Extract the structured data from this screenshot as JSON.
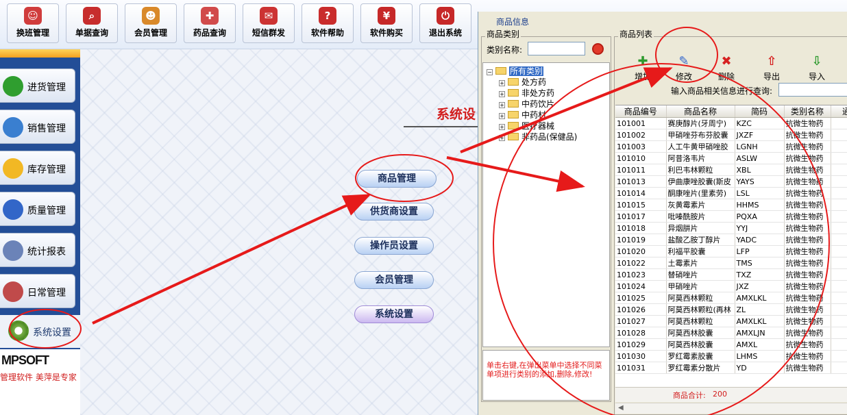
{
  "toolbar": {
    "buttons": [
      {
        "label": "换班管理",
        "icon": "user-switch-icon",
        "color": "#d03c3c"
      },
      {
        "label": "单据查询",
        "icon": "magnifier-icon",
        "color": "#c72d2d"
      },
      {
        "label": "会员管理",
        "icon": "member-icon",
        "color": "#d9892a"
      },
      {
        "label": "药品查询",
        "icon": "medicine-box-icon",
        "color": "#d14b4b"
      },
      {
        "label": "短信群发",
        "icon": "envelope-icon",
        "color": "#cc3333"
      },
      {
        "label": "软件帮助",
        "icon": "help-icon",
        "color": "#c92c2c"
      },
      {
        "label": "软件购买",
        "icon": "yen-icon",
        "color": "#c62828"
      },
      {
        "label": "退出系统",
        "icon": "power-icon",
        "color": "#c62828"
      }
    ]
  },
  "sidebar": {
    "items": [
      {
        "label": "进货管理",
        "icon": "plus-icon",
        "color": "#2f9e2f"
      },
      {
        "label": "销售管理",
        "icon": "pie-chart-icon",
        "color": "#3a7fd0"
      },
      {
        "label": "库存管理",
        "icon": "star-icon",
        "color": "#f2b824"
      },
      {
        "label": "质量管理",
        "icon": "cubes-icon",
        "color": "#3266c8"
      },
      {
        "label": "统计报表",
        "icon": "bar-chart-icon",
        "color": "#6b83b8"
      },
      {
        "label": "日常管理",
        "icon": "tools-icon",
        "color": "#c04a4a"
      }
    ],
    "active_label": "系统设置",
    "logo_text": "MPSOFT",
    "slogan": "管理软件 美萍是专家"
  },
  "main": {
    "title": "系统设",
    "buttons": [
      "商品管理",
      "供货商设置",
      "操作员设置",
      "会员管理",
      "系统设置"
    ]
  },
  "dialog": {
    "title": "商品信息",
    "category_group": "商品类别",
    "category_name_label": "类别名称:",
    "category_name_value": "",
    "tree_root": "所有类别",
    "tree_children": [
      "处方药",
      "非处方药",
      "中药饮片",
      "中药材",
      "医疗器械",
      "非药品(保健品)"
    ],
    "tip": "单击右键,在弹出菜单中选择不同菜单项进行类别的添加,删除,修改!",
    "list_group": "商品列表",
    "actions": [
      "增加",
      "修改",
      "删除",
      "导出",
      "导入"
    ],
    "search_label": "输入商品相关信息进行查询:",
    "search_value": "",
    "columns": [
      "商品编号",
      "商品名称",
      "简码",
      "类别名称",
      "通"
    ],
    "rows": [
      [
        "101001",
        "赛庚醇片(牙周宁)",
        "KZC",
        "抗微生物药"
      ],
      [
        "101002",
        "甲硝唑芬布芬胶囊",
        "JXZF",
        "抗微生物药"
      ],
      [
        "101003",
        "人工牛黄甲硝唑胶",
        "LGNH",
        "抗微生物药"
      ],
      [
        "101010",
        "阿昔洛韦片",
        "ASLW",
        "抗微生物药"
      ],
      [
        "101011",
        "利巴韦林颗粒",
        "XBL",
        "抗微生物药"
      ],
      [
        "101013",
        "伊曲康唑胶囊(斯皮",
        "YAYS",
        "抗微生物药"
      ],
      [
        "101014",
        "酮康唑片(里素劳)",
        "LSL",
        "抗微生物药"
      ],
      [
        "101015",
        "灰黄霉素片",
        "HHMS",
        "抗微生物药"
      ],
      [
        "101017",
        "吡嗪酰胺片",
        "PQXA",
        "抗微生物药"
      ],
      [
        "101018",
        "异烟肼片",
        "YYJ",
        "抗微生物药"
      ],
      [
        "101019",
        "盐酸乙胺丁醇片",
        "YADC",
        "抗微生物药"
      ],
      [
        "101020",
        "利福平胶囊",
        "LFP",
        "抗微生物药"
      ],
      [
        "101022",
        "土霉素片",
        "TMS",
        "抗微生物药"
      ],
      [
        "101023",
        "替硝唑片",
        "TXZ",
        "抗微生物药"
      ],
      [
        "101024",
        "甲硝唑片",
        "JXZ",
        "抗微生物药"
      ],
      [
        "101025",
        "阿莫西林颗粒",
        "AMXLKL",
        "抗微生物药"
      ],
      [
        "101026",
        "阿莫西林颗粒(再林",
        "ZL",
        "抗微生物药"
      ],
      [
        "101027",
        "阿莫西林颗粒",
        "AMXLKL",
        "抗微生物药"
      ],
      [
        "101028",
        "阿莫西林胶囊",
        "AMXLJN",
        "抗微生物药"
      ],
      [
        "101029",
        "阿莫西林胶囊",
        "AMXL",
        "抗微生物药"
      ],
      [
        "101030",
        "罗红霉素胶囊",
        "LHMS",
        "抗微生物药"
      ],
      [
        "101031",
        "罗红霉素分散片",
        "YD",
        "抗微生物药"
      ]
    ],
    "total_label": "商品合计:",
    "total_value": "200"
  }
}
